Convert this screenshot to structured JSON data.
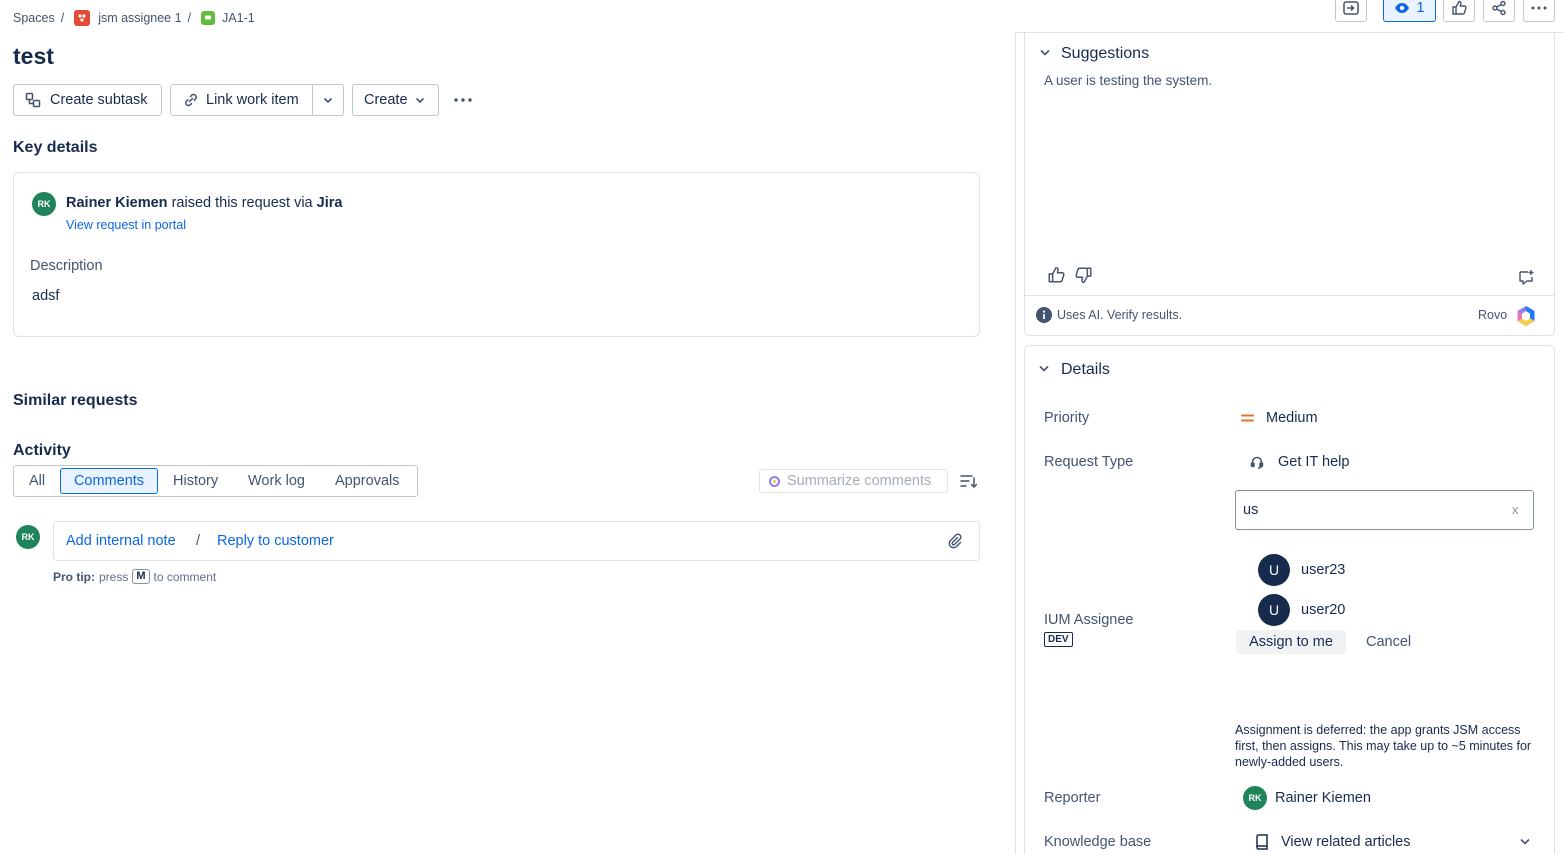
{
  "breadcrumb": {
    "spaces": "Spaces",
    "sep": "/",
    "project": "jsm assignee 1",
    "issue_key": "JA1-1"
  },
  "issue": {
    "title": "test"
  },
  "toolbar": {
    "create_subtask": "Create subtask",
    "link_work_item": "Link work item",
    "create": "Create"
  },
  "key_details": {
    "heading": "Key details",
    "reporter_name": "Rainer Kiemen",
    "raised_text": "raised this request via",
    "channel": "Jira",
    "view_portal": "View request in portal",
    "avatar_initials": "RK",
    "description_label": "Description",
    "description_value": "adsf"
  },
  "similar_requests": {
    "heading": "Similar requests"
  },
  "activity": {
    "heading": "Activity",
    "tabs": [
      "All",
      "Comments",
      "History",
      "Work log",
      "Approvals"
    ],
    "selected_tab": "Comments",
    "summarize": "Summarize comments",
    "add_internal_note": "Add internal note",
    "divider": "/",
    "reply_to_customer": "Reply to customer",
    "pro_tip_label": "Pro tip:",
    "pro_tip_press": "press",
    "pro_tip_key": "M",
    "pro_tip_rest": "to comment",
    "avatar_initials": "RK"
  },
  "top_actions": {
    "watchers_count": "1"
  },
  "suggestions": {
    "heading": "Suggestions",
    "text": "A user is testing the system.",
    "ai_note": "Uses AI. Verify results.",
    "rovo": "Rovo"
  },
  "details": {
    "heading": "Details",
    "priority_label": "Priority",
    "priority_value": "Medium",
    "request_type_label": "Request Type",
    "request_type_value": "Get IT help",
    "assignee_label": "IUM Assignee",
    "assignee_badge": "DEV",
    "search_value": "us",
    "clear": "x",
    "user_options": [
      {
        "initial": "U",
        "name": "user23"
      },
      {
        "initial": "U",
        "name": "user20"
      }
    ],
    "assign_to_me": "Assign to me",
    "cancel": "Cancel",
    "deferred_note": "Assignment is deferred: the app grants JSM access first, then assigns. This may take up to ~5 minutes for newly-added users.",
    "reporter_label": "Reporter",
    "reporter_initials": "RK",
    "reporter_value": "Rainer Kiemen",
    "kb_label": "Knowledge base",
    "kb_value": "View related articles"
  },
  "colors": {
    "accent": "#0c66e4",
    "avatar_green": "#1f845a",
    "avatar_navy": "#172b4d",
    "priority_medium": "#e2742f",
    "selected_tab_bg": "#e9f2ff"
  }
}
